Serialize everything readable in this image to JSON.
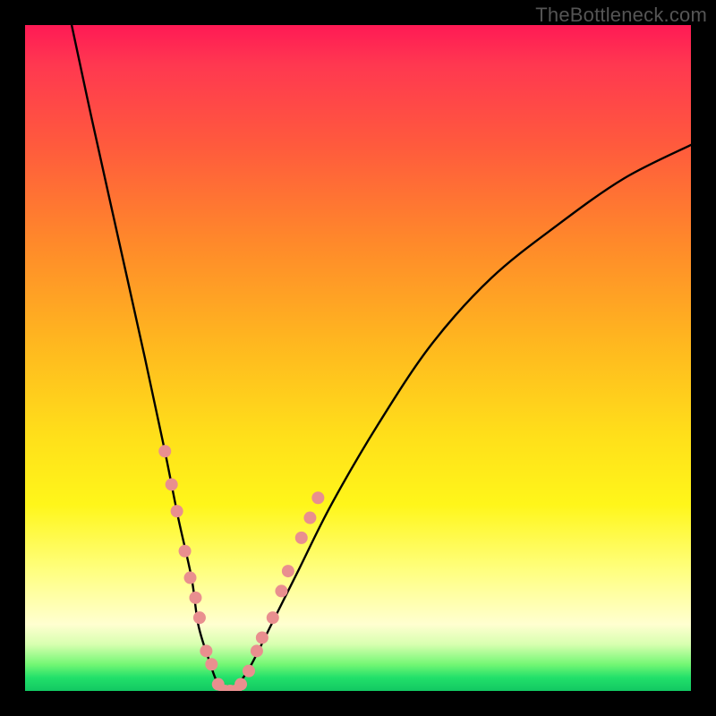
{
  "watermark": "TheBottleneck.com",
  "chart_data": {
    "type": "line",
    "title": "",
    "xlabel": "",
    "ylabel": "",
    "xlim": [
      0,
      100
    ],
    "ylim": [
      0,
      100
    ],
    "grid": false,
    "legend": false,
    "background_gradient": {
      "orientation": "vertical",
      "stops": [
        {
          "pos": 0.0,
          "color": "#ff1a55"
        },
        {
          "pos": 0.18,
          "color": "#ff5a3d"
        },
        {
          "pos": 0.48,
          "color": "#ffb81f"
        },
        {
          "pos": 0.72,
          "color": "#fff61a"
        },
        {
          "pos": 0.9,
          "color": "#ffffd0"
        },
        {
          "pos": 0.96,
          "color": "#74f774"
        },
        {
          "pos": 1.0,
          "color": "#12c862"
        }
      ]
    },
    "series": [
      {
        "name": "bottleneck-curve",
        "color": "#000000",
        "stroke_width": 2.4,
        "x": [
          7,
          10,
          14,
          18,
          21,
          23,
          25,
          26,
          27.5,
          29,
          30.5,
          32,
          34,
          37,
          41,
          46,
          53,
          61,
          70,
          80,
          90,
          100
        ],
        "y": [
          100,
          86,
          68,
          50,
          36,
          26,
          17,
          10,
          5,
          1,
          0,
          1,
          4,
          10,
          18,
          28,
          40,
          52,
          62,
          70,
          77,
          82
        ]
      }
    ],
    "markers": {
      "name": "highlighted-points",
      "color": "#e98f8f",
      "radius": 7,
      "points": [
        {
          "x": 21.0,
          "y": 36
        },
        {
          "x": 22.0,
          "y": 31
        },
        {
          "x": 22.8,
          "y": 27
        },
        {
          "x": 24.0,
          "y": 21
        },
        {
          "x": 24.8,
          "y": 17
        },
        {
          "x": 25.6,
          "y": 14
        },
        {
          "x": 26.2,
          "y": 11
        },
        {
          "x": 27.2,
          "y": 6
        },
        {
          "x": 28.0,
          "y": 4
        },
        {
          "x": 29.0,
          "y": 1
        },
        {
          "x": 30.0,
          "y": 0
        },
        {
          "x": 30.8,
          "y": 0
        },
        {
          "x": 31.6,
          "y": 0
        },
        {
          "x": 32.4,
          "y": 1
        },
        {
          "x": 33.6,
          "y": 3
        },
        {
          "x": 34.8,
          "y": 6
        },
        {
          "x": 35.6,
          "y": 8
        },
        {
          "x": 37.2,
          "y": 11
        },
        {
          "x": 38.5,
          "y": 15
        },
        {
          "x": 39.5,
          "y": 18
        },
        {
          "x": 41.5,
          "y": 23
        },
        {
          "x": 42.8,
          "y": 26
        },
        {
          "x": 44.0,
          "y": 29
        }
      ]
    }
  }
}
